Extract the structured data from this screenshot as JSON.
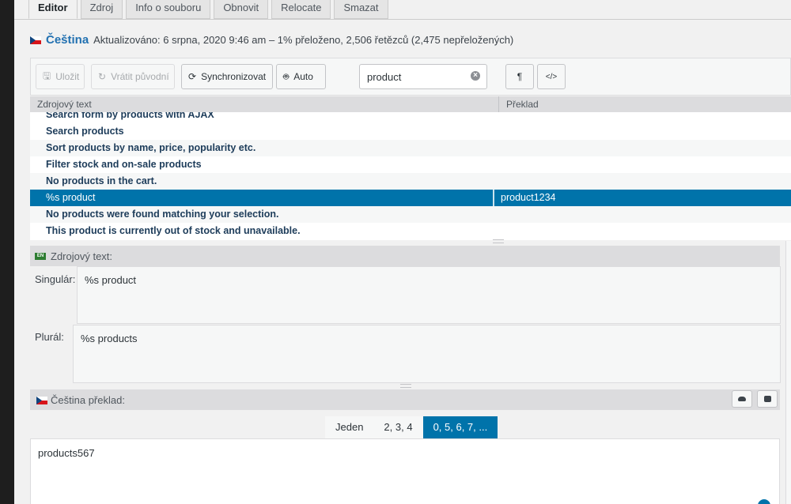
{
  "tabs": [
    "Editor",
    "Zdroj",
    "Info o souboru",
    "Obnovit",
    "Relocate",
    "Smazat"
  ],
  "header": {
    "language": "Čeština",
    "status": "Aktualizováno: 6 srpna, 2020 9:46 am – 1% přeloženo, 2,506 řetězců (2,475 nepřeložených)"
  },
  "toolbar": {
    "save": "Uložit",
    "revert": "Vrátit původní",
    "sync": "Synchronizovat",
    "auto": "Auto",
    "search_value": "product",
    "pilcrow": "¶",
    "code": "</>"
  },
  "list": {
    "col_source": "Zdrojový text",
    "col_translation": "Překlad",
    "rows": [
      {
        "source": "Search form by products with AJAX",
        "translation": ""
      },
      {
        "source": "Search products",
        "translation": ""
      },
      {
        "source": "Sort products by name, price, popularity etc.",
        "translation": ""
      },
      {
        "source": "Filter stock and on-sale products",
        "translation": ""
      },
      {
        "source": "No products in the cart.",
        "translation": ""
      },
      {
        "source": "%s product",
        "translation": "product1234"
      },
      {
        "source": "No products were found matching your selection.",
        "translation": ""
      },
      {
        "source": "This product is currently out of stock and unavailable.",
        "translation": ""
      }
    ]
  },
  "source_panel": {
    "badge": "EN",
    "title": "Zdrojový text:",
    "singular_label": "Singulár:",
    "singular_value": "%s product",
    "plural_label": "Plurál:",
    "plural_value": "%s products"
  },
  "translation_panel": {
    "title": "Čeština překlad:",
    "plural_tabs": [
      "Jeden",
      "2, 3, 4",
      "0, 5, 6, 7, ..."
    ],
    "value": "products567"
  }
}
